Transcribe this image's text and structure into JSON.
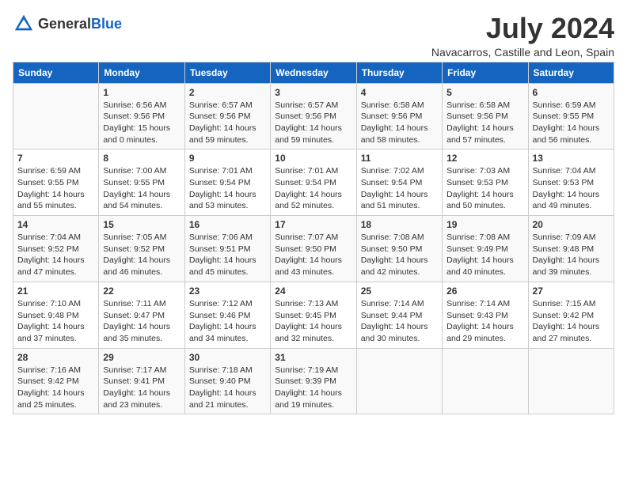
{
  "logo": {
    "text_general": "General",
    "text_blue": "Blue"
  },
  "header": {
    "month_title": "July 2024",
    "location": "Navacarros, Castille and Leon, Spain"
  },
  "weekdays": [
    "Sunday",
    "Monday",
    "Tuesday",
    "Wednesday",
    "Thursday",
    "Friday",
    "Saturday"
  ],
  "weeks": [
    [
      {
        "day": "",
        "info": ""
      },
      {
        "day": "1",
        "info": "Sunrise: 6:56 AM\nSunset: 9:56 PM\nDaylight: 15 hours\nand 0 minutes."
      },
      {
        "day": "2",
        "info": "Sunrise: 6:57 AM\nSunset: 9:56 PM\nDaylight: 14 hours\nand 59 minutes."
      },
      {
        "day": "3",
        "info": "Sunrise: 6:57 AM\nSunset: 9:56 PM\nDaylight: 14 hours\nand 59 minutes."
      },
      {
        "day": "4",
        "info": "Sunrise: 6:58 AM\nSunset: 9:56 PM\nDaylight: 14 hours\nand 58 minutes."
      },
      {
        "day": "5",
        "info": "Sunrise: 6:58 AM\nSunset: 9:56 PM\nDaylight: 14 hours\nand 57 minutes."
      },
      {
        "day": "6",
        "info": "Sunrise: 6:59 AM\nSunset: 9:55 PM\nDaylight: 14 hours\nand 56 minutes."
      }
    ],
    [
      {
        "day": "7",
        "info": "Sunrise: 6:59 AM\nSunset: 9:55 PM\nDaylight: 14 hours\nand 55 minutes."
      },
      {
        "day": "8",
        "info": "Sunrise: 7:00 AM\nSunset: 9:55 PM\nDaylight: 14 hours\nand 54 minutes."
      },
      {
        "day": "9",
        "info": "Sunrise: 7:01 AM\nSunset: 9:54 PM\nDaylight: 14 hours\nand 53 minutes."
      },
      {
        "day": "10",
        "info": "Sunrise: 7:01 AM\nSunset: 9:54 PM\nDaylight: 14 hours\nand 52 minutes."
      },
      {
        "day": "11",
        "info": "Sunrise: 7:02 AM\nSunset: 9:54 PM\nDaylight: 14 hours\nand 51 minutes."
      },
      {
        "day": "12",
        "info": "Sunrise: 7:03 AM\nSunset: 9:53 PM\nDaylight: 14 hours\nand 50 minutes."
      },
      {
        "day": "13",
        "info": "Sunrise: 7:04 AM\nSunset: 9:53 PM\nDaylight: 14 hours\nand 49 minutes."
      }
    ],
    [
      {
        "day": "14",
        "info": "Sunrise: 7:04 AM\nSunset: 9:52 PM\nDaylight: 14 hours\nand 47 minutes."
      },
      {
        "day": "15",
        "info": "Sunrise: 7:05 AM\nSunset: 9:52 PM\nDaylight: 14 hours\nand 46 minutes."
      },
      {
        "day": "16",
        "info": "Sunrise: 7:06 AM\nSunset: 9:51 PM\nDaylight: 14 hours\nand 45 minutes."
      },
      {
        "day": "17",
        "info": "Sunrise: 7:07 AM\nSunset: 9:50 PM\nDaylight: 14 hours\nand 43 minutes."
      },
      {
        "day": "18",
        "info": "Sunrise: 7:08 AM\nSunset: 9:50 PM\nDaylight: 14 hours\nand 42 minutes."
      },
      {
        "day": "19",
        "info": "Sunrise: 7:08 AM\nSunset: 9:49 PM\nDaylight: 14 hours\nand 40 minutes."
      },
      {
        "day": "20",
        "info": "Sunrise: 7:09 AM\nSunset: 9:48 PM\nDaylight: 14 hours\nand 39 minutes."
      }
    ],
    [
      {
        "day": "21",
        "info": "Sunrise: 7:10 AM\nSunset: 9:48 PM\nDaylight: 14 hours\nand 37 minutes."
      },
      {
        "day": "22",
        "info": "Sunrise: 7:11 AM\nSunset: 9:47 PM\nDaylight: 14 hours\nand 35 minutes."
      },
      {
        "day": "23",
        "info": "Sunrise: 7:12 AM\nSunset: 9:46 PM\nDaylight: 14 hours\nand 34 minutes."
      },
      {
        "day": "24",
        "info": "Sunrise: 7:13 AM\nSunset: 9:45 PM\nDaylight: 14 hours\nand 32 minutes."
      },
      {
        "day": "25",
        "info": "Sunrise: 7:14 AM\nSunset: 9:44 PM\nDaylight: 14 hours\nand 30 minutes."
      },
      {
        "day": "26",
        "info": "Sunrise: 7:14 AM\nSunset: 9:43 PM\nDaylight: 14 hours\nand 29 minutes."
      },
      {
        "day": "27",
        "info": "Sunrise: 7:15 AM\nSunset: 9:42 PM\nDaylight: 14 hours\nand 27 minutes."
      }
    ],
    [
      {
        "day": "28",
        "info": "Sunrise: 7:16 AM\nSunset: 9:42 PM\nDaylight: 14 hours\nand 25 minutes."
      },
      {
        "day": "29",
        "info": "Sunrise: 7:17 AM\nSunset: 9:41 PM\nDaylight: 14 hours\nand 23 minutes."
      },
      {
        "day": "30",
        "info": "Sunrise: 7:18 AM\nSunset: 9:40 PM\nDaylight: 14 hours\nand 21 minutes."
      },
      {
        "day": "31",
        "info": "Sunrise: 7:19 AM\nSunset: 9:39 PM\nDaylight: 14 hours\nand 19 minutes."
      },
      {
        "day": "",
        "info": ""
      },
      {
        "day": "",
        "info": ""
      },
      {
        "day": "",
        "info": ""
      }
    ]
  ]
}
